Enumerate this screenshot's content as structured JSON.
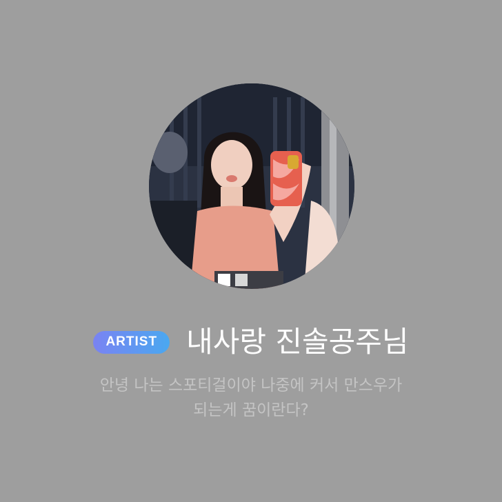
{
  "profile": {
    "badge": "ARTIST",
    "name": "내사랑 진솔공주님",
    "bio": "안녕 나는 스포티걸이야 나중에 커서 만스우가\n되는게 꿈이란다?",
    "avatar_alt": "profile-photo"
  },
  "colors": {
    "background": "#9e9e9e",
    "badge_gradient_start": "#7a83f2",
    "badge_gradient_end": "#4aa8f0",
    "name": "#ffffff",
    "bio": "#c4c4c4"
  }
}
